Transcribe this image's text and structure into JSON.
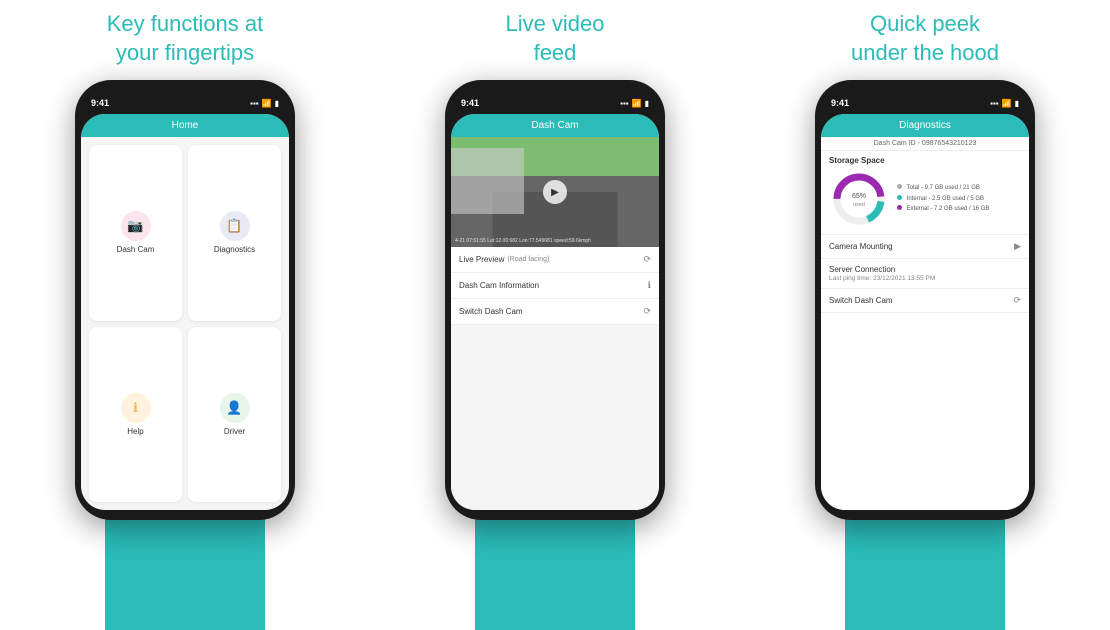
{
  "columns": [
    {
      "title_line1": "Key functions at",
      "title_line2": "your fingertips",
      "phone": {
        "time": "9:41",
        "screen_title": "Home",
        "tiles": [
          {
            "icon": "📷",
            "label": "Dash Cam",
            "color": "#f48fb1",
            "bg": "#fce4ec"
          },
          {
            "icon": "📋",
            "label": "Diagnostics",
            "color": "#7986cb",
            "bg": "#e8eaf6"
          },
          {
            "icon": "ℹ",
            "label": "Help",
            "color": "#ffb74d",
            "bg": "#fff3e0"
          },
          {
            "icon": "👤",
            "label": "Driver",
            "color": "#66bb6a",
            "bg": "#e8f5e9"
          }
        ]
      }
    },
    {
      "title_line1": "Live video",
      "title_line2": "feed",
      "phone": {
        "time": "9:41",
        "screen_title": "Dash Cam",
        "video_overlay": "4-21 07:51:55 Lat:12.00:682 Lon:77.549681 speed:59.6kmph",
        "menu_items": [
          {
            "label": "Live Preview",
            "sub": "(Road facing)",
            "icon": "⟳"
          },
          {
            "label": "Dash Cam Information",
            "sub": "",
            "icon": "ℹ"
          },
          {
            "label": "Switch Dash Cam",
            "sub": "",
            "icon": "⟳"
          }
        ]
      }
    },
    {
      "title_line1": "Quick peek",
      "title_line2": "under the hood",
      "phone": {
        "time": "9:41",
        "screen_title": "Diagnostics",
        "dashcam_id": "Dash Cam ID - 09876543210123",
        "storage": {
          "title": "Storage Space",
          "percent": 65,
          "label": "65% used",
          "legend": [
            {
              "color": "#aaa",
              "text": "Total - 9.7 GB used / 21 GB"
            },
            {
              "color": "#2bbcb8",
              "text": "Internal - 2.5 GB used / 5 GB"
            },
            {
              "color": "#9c27b0",
              "text": "External - 7.2 GB used / 16 GB"
            }
          ]
        },
        "diag_rows": [
          {
            "title": "Camera Mounting",
            "sub": "",
            "icon": "▶"
          },
          {
            "title": "Server Connection",
            "sub": "Last ping time: 23/12/2021 13:55 PM",
            "icon": ""
          },
          {
            "title": "Switch Dash Cam",
            "sub": "",
            "icon": "⟳"
          }
        ]
      }
    }
  ]
}
